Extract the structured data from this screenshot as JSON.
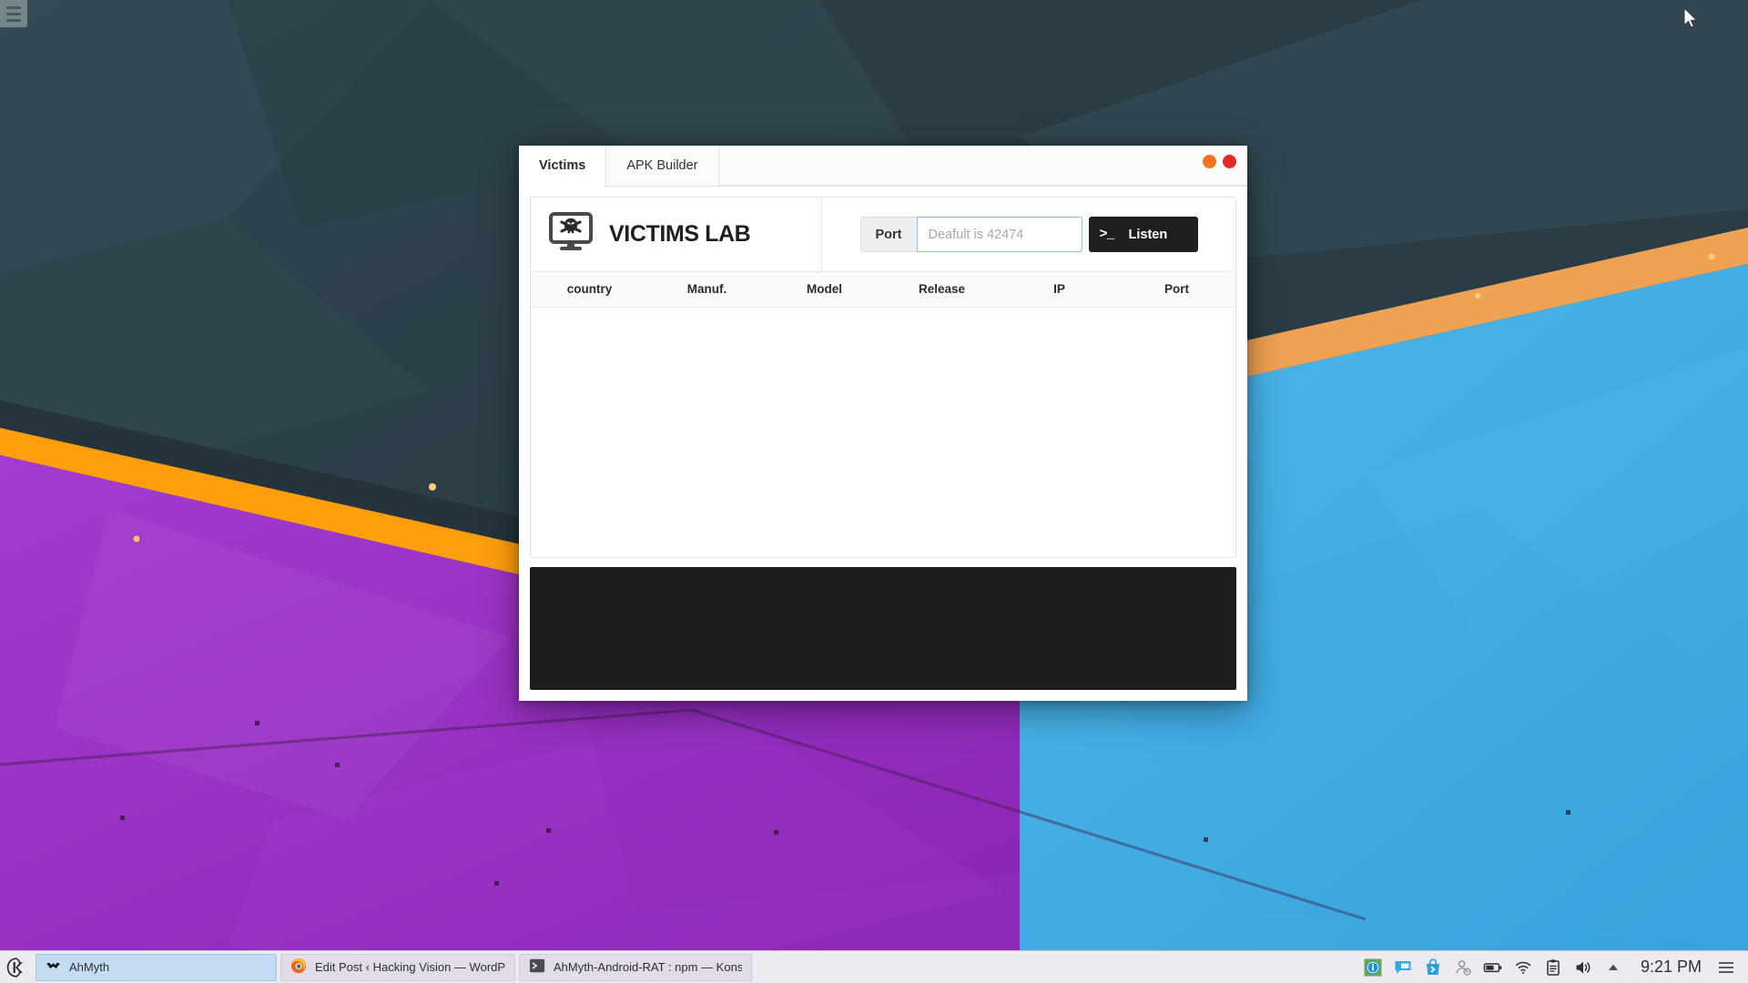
{
  "desktop": {
    "toolbox_name": "desktop-toolbox",
    "wallpaper_colors": {
      "teal_dark": "#2b3c3c",
      "teal_mid": "#33484f",
      "teal_light": "#3d555c",
      "orange": "#ff9e0d",
      "orange_soft": "#efa254",
      "blue": "#45b0e3",
      "purple": "#9b30c8",
      "purple_light": "#b455d6"
    }
  },
  "window": {
    "tabs": [
      {
        "label": "Victims",
        "active": true
      },
      {
        "label": "APK Builder",
        "active": false
      }
    ],
    "controls": {
      "minimize_color": "#f37321",
      "close_color": "#e02b27"
    },
    "brand": {
      "title": "VICTIMS LAB",
      "icon": "skull-monitor-icon"
    },
    "port": {
      "label": "Port",
      "value": "",
      "placeholder": "Deafult is 42474"
    },
    "listen_button": {
      "label": "Listen",
      "glyph": ">_"
    },
    "table": {
      "columns": [
        "country",
        "Manuf.",
        "Model",
        "Release",
        "IP",
        "Port"
      ],
      "rows": []
    },
    "console": {
      "text": ""
    }
  },
  "panel": {
    "launcher": {
      "name": "kickoff-launcher"
    },
    "tasks": [
      {
        "label": "AhMyth",
        "icon": "ahmyth-bat-icon",
        "active": true
      },
      {
        "label": "Edit Post ‹ Hacking Vision — WordPr",
        "icon": "firefox-icon",
        "active": false
      },
      {
        "label": "AhMyth-Android-RAT : npm — Kons",
        "icon": "konsole-icon",
        "active": false
      }
    ],
    "tray": [
      "info-icon",
      "chat-icon",
      "software-store-icon",
      "user-offline-icon",
      "battery-icon",
      "wifi-icon",
      "clipboard-icon",
      "volume-icon",
      "show-hidden-icons-arrow"
    ],
    "clock": "9:21 PM"
  }
}
